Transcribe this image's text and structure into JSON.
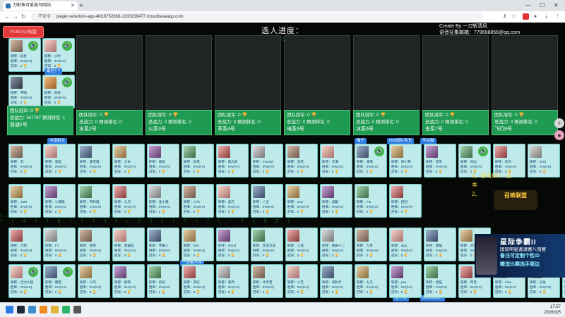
{
  "browser": {
    "tab_title": "刀削鱼可爱选马网站",
    "address_security": "不安全",
    "address_url": "player-selection-app-4bl19752858-1300158477.tcloudbaseapp.com"
  },
  "header": {
    "pubg_button": "PUBG火热版",
    "progress_label": "选人进度：",
    "credit_line1": "Create By 一刀斩清风",
    "credit_line2": "语音征集邮箱：779608856@qq.com"
  },
  "teams": [
    {
      "title": "团队冠军: 0 🏆",
      "power": "总战力: 167797 预测排名: 1",
      "name": "普通1号"
    },
    {
      "title": "团队冠军: 0 🏆",
      "power": "总战力: 0 预测排名: 0",
      "name": "水系2号"
    },
    {
      "title": "团队冠军: 0 🏆",
      "power": "总战力: 0 预测排名: 0",
      "name": "火系3号"
    },
    {
      "title": "团队冠军: 0 🏆",
      "power": "总战力: 0 预测排名: 0",
      "name": "草系4号"
    },
    {
      "title": "团队冠军: 0 🏆",
      "power": "总战力: 0 预测排名: 0",
      "name": "电系5号"
    },
    {
      "title": "团队冠军: 0 🏆",
      "power": "总战力: 0 预测排名: 0",
      "name": "冰系6号"
    },
    {
      "title": "团队冠军: 0 🏆",
      "power": "总战力: 0 预测排名: 0",
      "name": "虫系7号"
    },
    {
      "title": "团队冠军: 0 🏆",
      "power": "总战力: 0 预测排名: 0",
      "name": "飞行8号"
    }
  ],
  "team1_badge": "最佳? ?",
  "team1_players": [
    {
      "name": "昵称：极星",
      "rate": "胜率：0%(0-0)",
      "champ": "冠军：0",
      "trophy": "🏆"
    },
    {
      "name": "昵称：小叶",
      "rate": "胜率：0%(0-0)",
      "champ": "冠军：0",
      "trophy": "🏆"
    },
    {
      "name": "昵称：甲喵",
      "rate": "胜率：0%(0-0)",
      "champ": "冠军：0",
      "trophy": "🏆"
    },
    {
      "name": "昵称：星妖",
      "rate": "胜率：0%(0-0)",
      "champ": "冠军：0",
      "trophy": "🏆"
    }
  ],
  "tags": {
    "t1": "中国机长",
    "t2": "喵子",
    "t3": "OG战队-队长",
    "t4": "平台猫",
    "t5": "一点都不熊",
    "t6": "勇了么",
    "t7": "8000局精神"
  },
  "pool_rows": [
    [
      "昵称：凯",
      "昵称：蛋蛋",
      "昵称：森宝姐",
      "昵称：大米",
      "昵称：晨星",
      "昵称：秋景",
      "昵称：猴九抓",
      "昵称：mocted",
      "昵称：温花",
      "昵称：艾满",
      "昵称：唐唐",
      "昵称：果小茶",
      "昵称：宝哥",
      "昵称：鸡凶",
      "昵称：欢欢",
      "昵称：Zerd"
    ],
    [
      "昵称：XDD",
      "昵称：小城喵",
      "昵称：燕铃喵",
      "昵称：九点",
      "昵称：金小狐",
      "昵称：小木",
      "昵称：蓝石",
      "昵称：八五",
      "昵称：icon",
      "昵称：温暖",
      "昵称：FIII",
      "昵称：团团"
    ],
    [
      "昵称：乌鸦",
      "昵称：FY",
      "昵称：超哥",
      "昵称：金猫怪",
      "昵称：零葡八",
      "昵称：kiss",
      "昵称：mood",
      "昵称：皇坊艾美",
      "昵称：小鬼",
      "昵称：晚辰十二",
      "昵称：九月",
      "昵称：qiqu",
      "昵称：夜猫",
      "昵称：木头"
    ],
    [
      "昵称：活力小猫",
      "昵称：慢宝",
      "昵称：小鸟",
      "昵称：刚琪",
      "昵称：初初",
      "昵称：美忆",
      "昵称：悬乔",
      "昵称：冰手苦",
      "昵称：小艺",
      "昵称：海豹手",
      "昵称：七天",
      "昵称：yaa",
      "昵称：虎猫",
      "昵称：阿月",
      "昵称：Aloa",
      "昵称：乐总",
      "昵称：老川"
    ]
  ],
  "pool_line2": "胜率：0%(0-0)",
  "pool_line3": "冠军：0",
  "rules_text": {
    "line1": "1、游戏DD，选",
    "line2": "本",
    "line3": "2、"
  },
  "game_logo": "召唤联盟",
  "ad": {
    "title": "星际争霸II",
    "subtitle": "国际明星邀请赛八强赛",
    "line3": "备注可定制个性ID",
    "line4": "赠送比赛选手周边"
  },
  "clock": {
    "time": "17:57",
    "date": "2026/3/5"
  }
}
